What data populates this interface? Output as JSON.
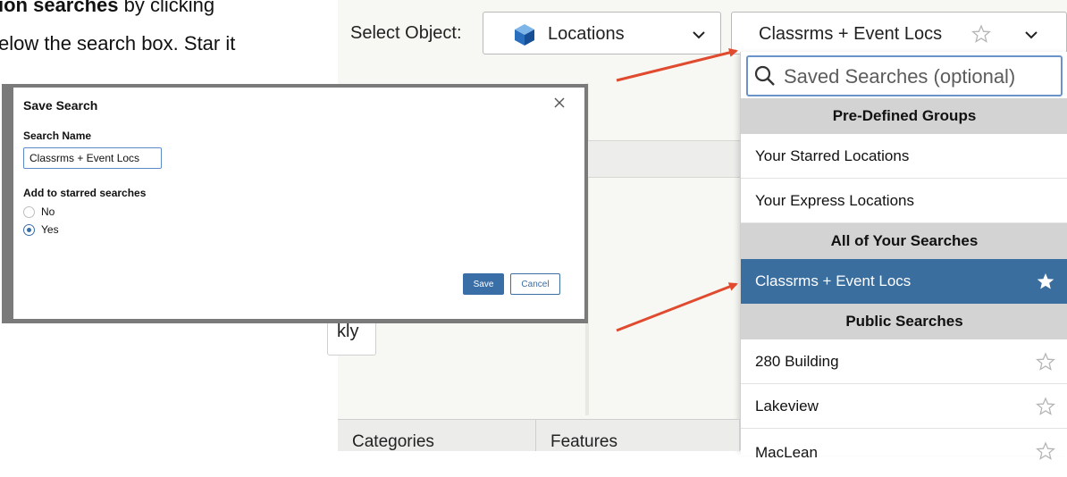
{
  "instruction": {
    "line1_bold": "ion searches",
    "line1_rest": " by clicking",
    "line2": "elow the search box. Star it"
  },
  "toolbar": {
    "select_object_label": "Select Object:",
    "object_value": "Locations",
    "object_icon": "cube-icon",
    "saved_search_value": "Classrms + Event Locs"
  },
  "dropdown": {
    "search_placeholder": "Saved Searches (optional)",
    "groups": [
      {
        "label": "Pre-Defined Groups"
      },
      {
        "label": "All of Your Searches"
      },
      {
        "label": "Public Searches"
      }
    ],
    "items": [
      {
        "label": "Your Starred Locations"
      },
      {
        "label": "Your Express Locations"
      },
      {
        "label": "Classrms + Event Locs",
        "selected": true,
        "starred": true
      },
      {
        "label": "280 Building",
        "starred": false
      },
      {
        "label": "Lakeview",
        "starred": false
      },
      {
        "label": "MacLean",
        "starred": false
      }
    ],
    "accent_color": "#3a6e9f"
  },
  "background": {
    "weekly_fragment": "kly",
    "tabs": [
      "Categories",
      "Features"
    ]
  },
  "modal": {
    "title": "Save Search",
    "name_label": "Search Name",
    "name_value": "Classrms + Event Locs",
    "starred_label": "Add to starred searches",
    "options": [
      {
        "label": "No",
        "checked": false
      },
      {
        "label": "Yes",
        "checked": true
      }
    ],
    "save_label": "Save",
    "cancel_label": "Cancel"
  },
  "annotation_color": "#e04a2e"
}
